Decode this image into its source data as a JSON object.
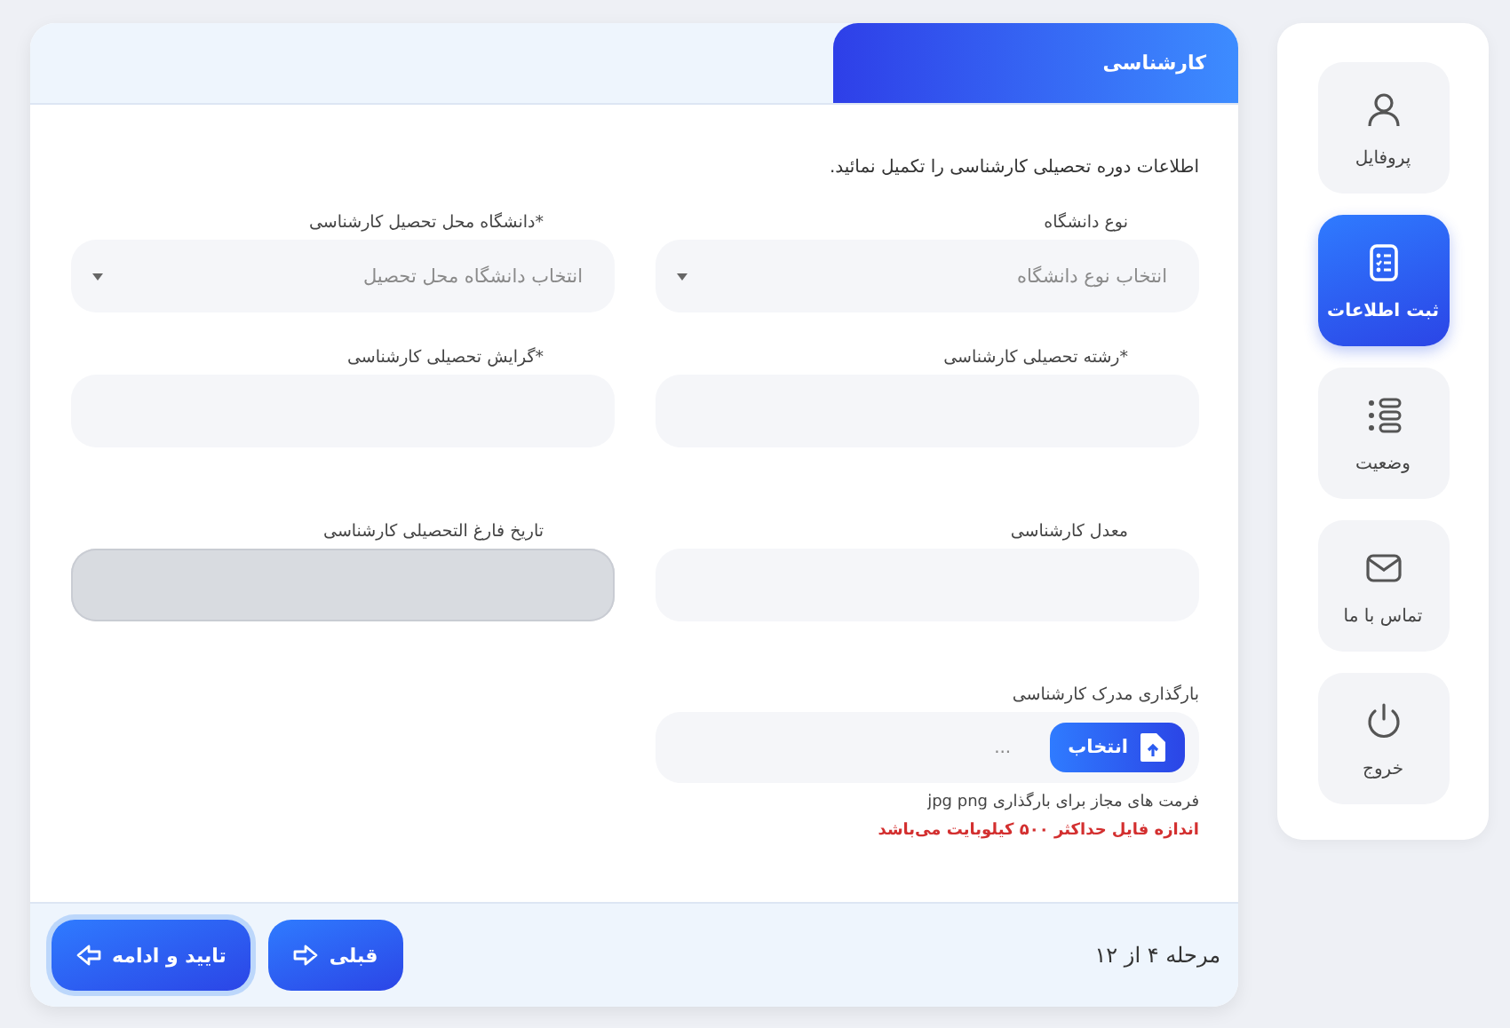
{
  "sidebar": {
    "items": [
      {
        "label": "پروفایل",
        "selected": false
      },
      {
        "label": "ثبت اطلاعات",
        "selected": true
      },
      {
        "label": "وضعیت",
        "selected": false
      },
      {
        "label": "تماس با ما",
        "selected": false
      },
      {
        "label": "خروج",
        "selected": false
      }
    ]
  },
  "tabs": [
    {
      "label": "کارشناسی",
      "selected": true
    }
  ],
  "intro": "اطلاعات دوره تحصیلی کارشناسی را تکمیل نمائید.",
  "fields": [
    {
      "kind": "select",
      "label": "نوع دانشگاه",
      "placeholder": "انتخاب نوع دانشگاه",
      "disabled": false
    },
    {
      "kind": "select",
      "label": "*دانشگاه محل تحصیل کارشناسی",
      "placeholder": "انتخاب دانشگاه محل تحصیل",
      "disabled": false
    },
    {
      "kind": "input",
      "label": "*رشته تحصیلی کارشناسی",
      "disabled": false
    },
    {
      "kind": "input",
      "label": "*گرایش تحصیلی کارشناسی",
      "disabled": false
    },
    {
      "kind": "input",
      "label": "معدل کارشناسی",
      "disabled": false
    },
    {
      "kind": "input",
      "label": "تاریخ فارغ التحصیلی کارشناسی",
      "disabled": true
    }
  ],
  "upload": {
    "label": "بارگذاری مدرک کارشناسی",
    "button": "انتخاب",
    "value": "...",
    "notes": [
      {
        "kind": "info",
        "text": "فرمت های مجاز برای بارگذاری jpg png"
      },
      {
        "kind": "error",
        "text": "اندازه فایل حداکثر ۵۰۰ کیلوبایت می‌باشد"
      }
    ]
  },
  "footer": {
    "step": "مرحله ۴ از ۱۲",
    "buttons": [
      {
        "kind": "secondary",
        "label": "قبلی"
      },
      {
        "kind": "primary",
        "label": "تایید و ادامه"
      }
    ]
  }
}
